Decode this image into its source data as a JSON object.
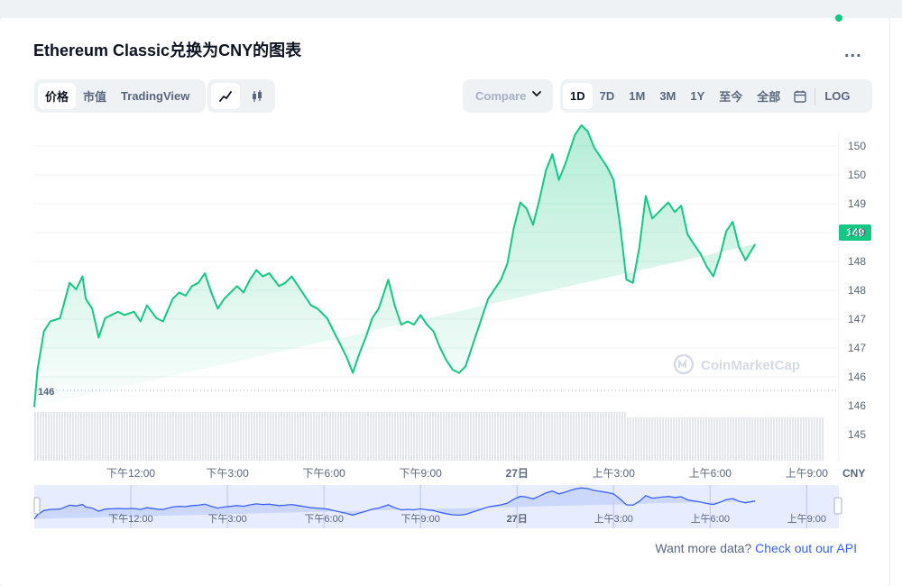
{
  "header": {
    "title": "Ethereum Classic兑换为CNY的图表",
    "more_label": "..."
  },
  "toolbar": {
    "view_tabs": [
      "价格",
      "市值",
      "TradingView"
    ],
    "compare_label": "Compare",
    "ranges": [
      "1D",
      "7D",
      "1M",
      "3M",
      "1Y",
      "至今",
      "全部"
    ],
    "log_label": "LOG"
  },
  "chart_data": {
    "type": "area",
    "currency_label": "CNY",
    "current_price_label": "149",
    "baseline_label": "146",
    "watermark": "CoinMarketCap",
    "y_ticks": [
      "150",
      "150",
      "149",
      "149",
      "148",
      "148",
      "147",
      "147",
      "146",
      "146",
      "145"
    ],
    "x_ticks": [
      "下午12:00",
      "下午3:00",
      "下午6:00",
      "下午9:00",
      "27日",
      "上午3:00",
      "上午6:00",
      "上午9:00"
    ],
    "x_tick_hours": [
      12,
      15,
      18,
      21,
      24,
      27,
      30,
      33
    ],
    "ylim": [
      145.2,
      150.3
    ],
    "x": [
      9.0,
      9.1,
      9.3,
      9.5,
      9.8,
      10.1,
      10.3,
      10.5,
      10.6,
      10.8,
      11.0,
      11.2,
      11.4,
      11.6,
      11.8,
      12.1,
      12.3,
      12.5,
      12.8,
      13.0,
      13.3,
      13.5,
      13.7,
      13.9,
      14.1,
      14.3,
      14.5,
      14.7,
      14.9,
      15.1,
      15.3,
      15.5,
      15.7,
      15.9,
      16.1,
      16.3,
      16.6,
      16.8,
      17.0,
      17.2,
      17.4,
      17.6,
      17.8,
      18.1,
      18.3,
      18.5,
      18.7,
      18.9,
      19.1,
      19.3,
      19.5,
      19.7,
      20.0,
      20.2,
      20.4,
      20.6,
      20.8,
      21.0,
      21.2,
      21.4,
      21.6,
      21.8,
      22.0,
      22.2,
      22.4,
      22.6,
      22.9,
      23.1,
      23.3,
      23.5,
      23.7,
      23.9,
      24.1,
      24.3,
      24.5,
      24.7,
      24.9,
      25.1,
      25.3,
      25.5,
      25.8,
      26.0,
      26.2,
      26.4,
      26.6,
      26.8,
      27.0,
      27.2,
      27.4,
      27.6,
      27.8,
      28.0,
      28.2,
      28.5,
      28.7,
      28.9,
      29.1,
      29.3,
      29.5,
      29.7,
      29.9,
      30.1,
      30.3,
      30.5,
      30.7,
      30.9,
      31.1,
      31.4,
      31.6,
      31.8,
      32.0,
      32.2,
      32.4,
      32.6,
      32.8,
      33.0,
      33.2,
      33.4,
      33.6,
      33.8,
      34.0
    ],
    "y": [
      146.02,
      146.6,
      147.2,
      147.35,
      147.4,
      147.95,
      147.85,
      148.05,
      147.7,
      147.55,
      147.1,
      147.4,
      147.45,
      147.5,
      147.45,
      147.5,
      147.35,
      147.6,
      147.4,
      147.35,
      147.7,
      147.8,
      147.75,
      147.9,
      147.95,
      148.1,
      147.8,
      147.55,
      147.7,
      147.8,
      147.9,
      147.8,
      148.0,
      148.15,
      148.05,
      148.1,
      147.9,
      147.95,
      148.05,
      147.9,
      147.75,
      147.6,
      147.55,
      147.4,
      147.2,
      147.0,
      146.8,
      146.55,
      146.85,
      147.1,
      147.4,
      147.55,
      148.0,
      147.6,
      147.3,
      147.35,
      147.3,
      147.45,
      147.3,
      147.2,
      146.95,
      146.75,
      146.6,
      146.55,
      146.65,
      146.95,
      147.4,
      147.7,
      147.85,
      148.0,
      148.25,
      148.8,
      149.2,
      149.1,
      148.85,
      149.25,
      149.7,
      149.95,
      149.55,
      149.8,
      150.25,
      150.4,
      150.3,
      150.05,
      149.9,
      149.75,
      149.55,
      148.85,
      148.0,
      147.95,
      148.5,
      149.3,
      148.95,
      149.1,
      149.2,
      149.05,
      149.15,
      148.7,
      148.55,
      148.4,
      148.2,
      148.05,
      148.35,
      148.75,
      148.9,
      148.5,
      148.3,
      148.55
    ],
    "series": [
      {
        "name": "价格",
        "color": "#16c784"
      }
    ]
  },
  "navigator": {
    "x_ticks": [
      "下午12:00",
      "下午3:00",
      "下午6:00",
      "下午9:00",
      "27日",
      "上午3:00",
      "上午6:00",
      "上午9:00"
    ]
  },
  "footer": {
    "prompt_text": "Want more data?",
    "link_text": "Check out our API"
  },
  "colors": {
    "accent_green": "#16c784",
    "link_blue": "#3861fb",
    "navigator_fill": "#d7e0fd"
  }
}
